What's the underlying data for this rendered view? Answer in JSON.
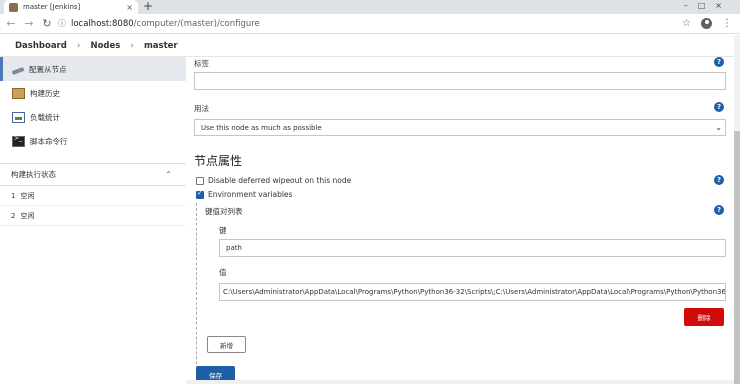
{
  "browser": {
    "tab_title": "master [Jenkins]",
    "tab_close": "×",
    "new_tab": "+",
    "window_buttons": "–□×",
    "url_host": "localhost:8080",
    "url_path": "/computer/(master)/configure"
  },
  "breadcrumb": [
    "Dashboard",
    "Nodes",
    "master"
  ],
  "breadcrumb_sep": "›",
  "sidebar": {
    "items": [
      {
        "label": "配置从节点",
        "icon": "wrench-screwdriver-icon"
      },
      {
        "label": "构建历史",
        "icon": "notepad-icon"
      },
      {
        "label": "负载统计",
        "icon": "monitor-chart-icon"
      },
      {
        "label": "脚本命令行",
        "icon": "terminal-icon"
      }
    ],
    "executor_panel": {
      "title": "构建执行状态",
      "rows": [
        {
          "num": "1",
          "status": "空闲"
        },
        {
          "num": "2",
          "status": "空闲"
        }
      ]
    }
  },
  "form": {
    "labels_label": "标签",
    "labels_value": "",
    "usage_label": "用法",
    "usage_value": "Use this node as much as possible",
    "node_properties_title": "节点属性",
    "disable_wipeout_label": "Disable deferred wipeout on this node",
    "disable_wipeout_checked": false,
    "env_vars_label": "Environment variables",
    "env_vars_checked": true,
    "kv_list_label": "键值对列表",
    "key_label": "键",
    "key_value": "path",
    "value_label": "值",
    "value_value": "C:\\Users\\Administrator\\AppData\\Local\\Programs\\Python\\Python36-32\\Scripts\\;C:\\Users\\Administrator\\AppData\\Local\\Programs\\Python\\Python36-3",
    "delete_button": "删除",
    "add_button": "新增",
    "save_button": "保存",
    "help": "?"
  },
  "colors": {
    "primary": "#1f5fa8",
    "danger": "#d20a0a"
  }
}
